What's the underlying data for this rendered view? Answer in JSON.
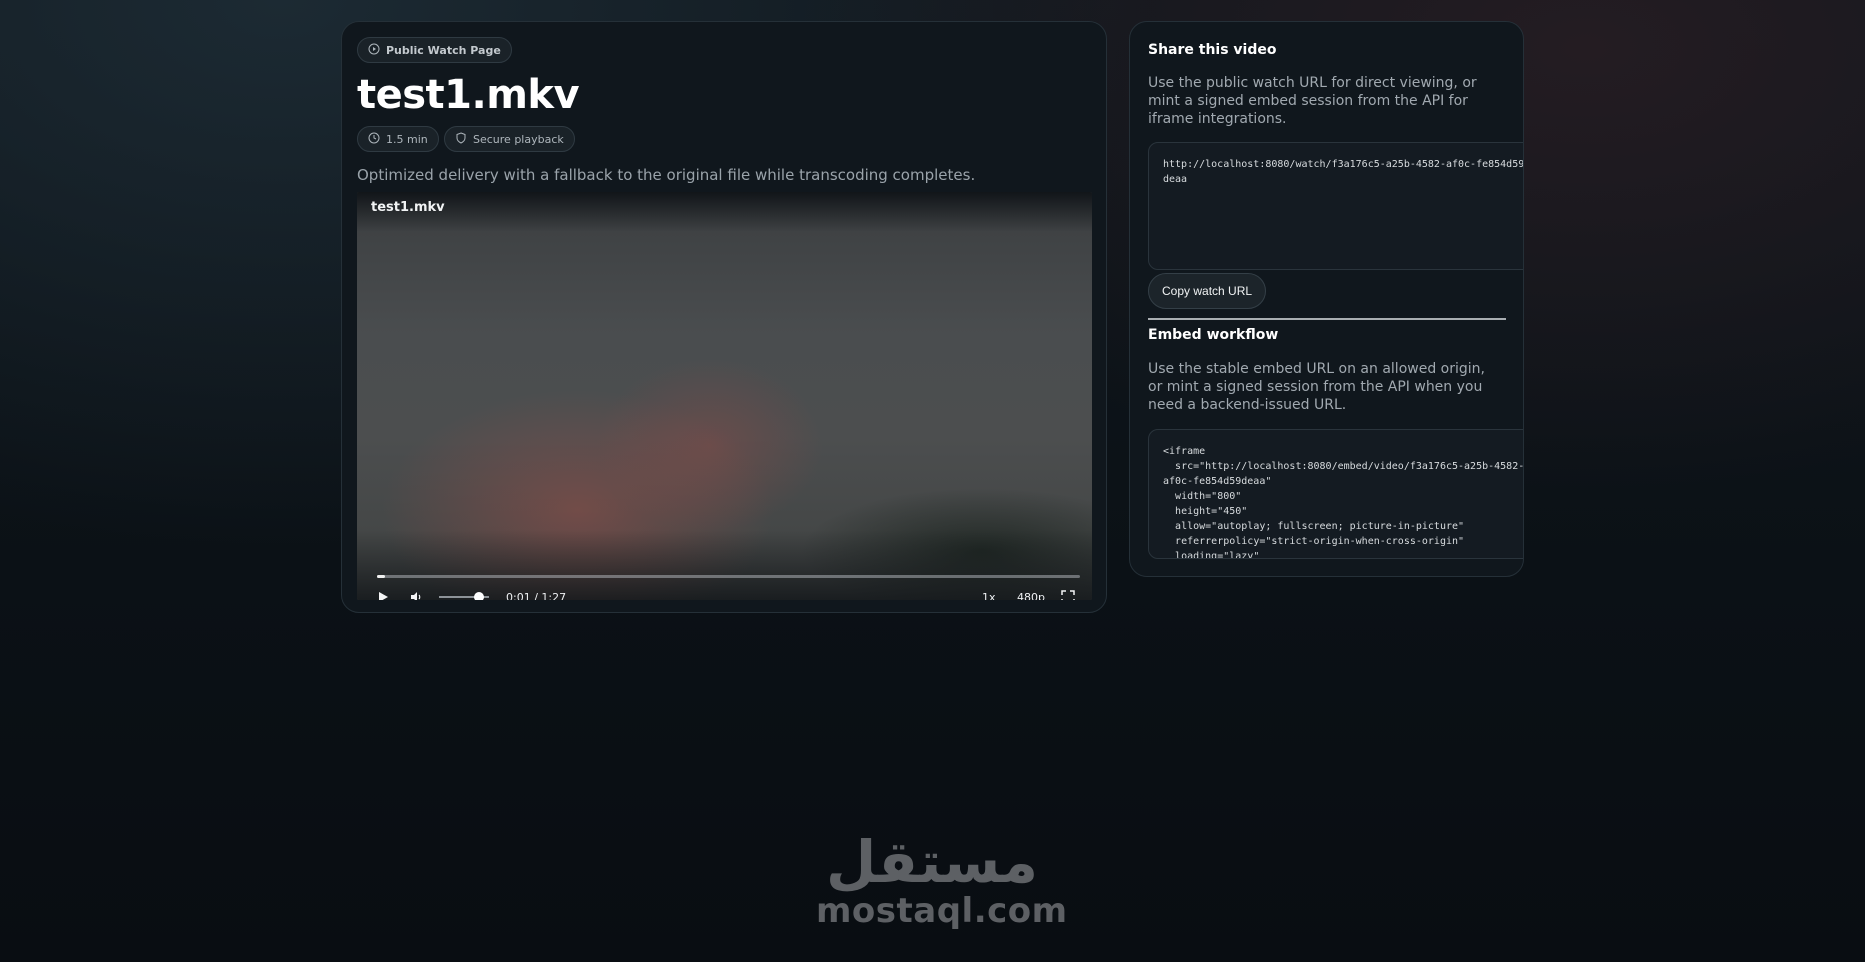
{
  "main": {
    "page_badge": "Public Watch Page",
    "title": "test1.mkv",
    "duration_badge": "1.5 min",
    "security_badge": "Secure playback",
    "description": "Optimized delivery with a fallback to the original file while transcoding completes."
  },
  "player": {
    "title": "test1.mkv",
    "time": "0:01 / 1:27",
    "progress": 0.011,
    "volume": 0.8,
    "speed": "1x",
    "quality": "480p"
  },
  "share": {
    "title": "Share this video",
    "description": "Use the public watch URL for direct viewing, or mint a signed embed session from the API for iframe integrations.",
    "watch_url": "http://localhost:8080/watch/f3a176c5-a25b-4582-af0c-fe854d59deaa",
    "copy_label": "Copy watch URL",
    "embed_title": "Embed workflow",
    "embed_description": "Use the stable embed URL on an allowed origin, or mint a signed session from the API when you need a backend-issued URL.",
    "embed_code": "<iframe\n  src=\"http://localhost:8080/embed/video/f3a176c5-a25b-4582-af0c-fe854d59deaa\"\n  width=\"800\"\n  height=\"450\"\n  allow=\"autoplay; fullscreen; picture-in-picture\"\n  referrerpolicy=\"strict-origin-when-cross-origin\"\n  loading=\"lazy\""
  },
  "watermark": {
    "arabic": "مستقل",
    "latin": "mostaql.com"
  },
  "icons": {
    "page_badge": "play-circle-icon",
    "duration": "clock-icon",
    "security": "shield-icon",
    "play": "play-icon",
    "volume": "volume-icon",
    "fullscreen": "fullscreen-icon"
  }
}
